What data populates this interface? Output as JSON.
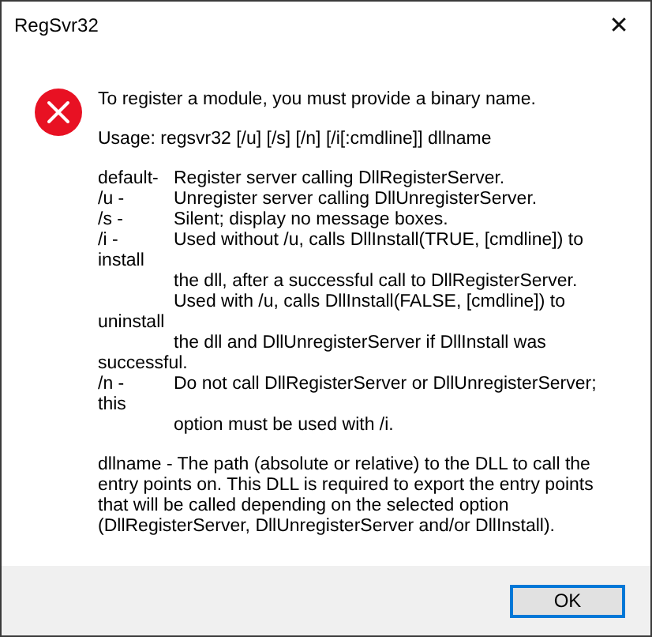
{
  "window": {
    "title": "RegSvr32",
    "close": "✕"
  },
  "message": "To register a module, you must provide a binary name.",
  "usage": "Usage: regsvr32 [/u] [/s] [/n] [/i[:cmdline]] dllname",
  "options": [
    {
      "kind": "option",
      "flag": "default-",
      "text": "Register server calling DllRegisterServer."
    },
    {
      "kind": "option",
      "flag": "/u -",
      "text": "Unregister server calling DllUnregisterServer."
    },
    {
      "kind": "option",
      "flag": "/s -",
      "text": "Silent; display no message boxes."
    },
    {
      "kind": "option",
      "flag": "/i -",
      "text": "Used without /u, calls DllInstall(TRUE, [cmdline]) to"
    },
    {
      "kind": "wrapped",
      "text": "install"
    },
    {
      "kind": "continued",
      "text": "the dll, after a successful call to DllRegisterServer."
    },
    {
      "kind": "continued",
      "text": "Used with /u, calls DllInstall(FALSE, [cmdline]) to"
    },
    {
      "kind": "wrapped",
      "text": "uninstall"
    },
    {
      "kind": "continued",
      "text": "the dll and DllUnregisterServer if DllInstall was"
    },
    {
      "kind": "wrapped",
      "text": "successful."
    },
    {
      "kind": "option",
      "flag": "/n -",
      "text": "Do not call DllRegisterServer or DllUnregisterServer;"
    },
    {
      "kind": "wrapped",
      "text": "this"
    },
    {
      "kind": "continued",
      "text": "option must be used with /i."
    }
  ],
  "dllname_paragraph": [
    "dllname - The path (absolute or relative) to the DLL to call the",
    "entry points on. This DLL is required to export the entry points",
    "that will be called depending on the selected option",
    "(DllRegisterServer, DllUnregisterServer and/or DllInstall)."
  ],
  "buttons": [
    {
      "label": "OK",
      "selected": true
    }
  ]
}
